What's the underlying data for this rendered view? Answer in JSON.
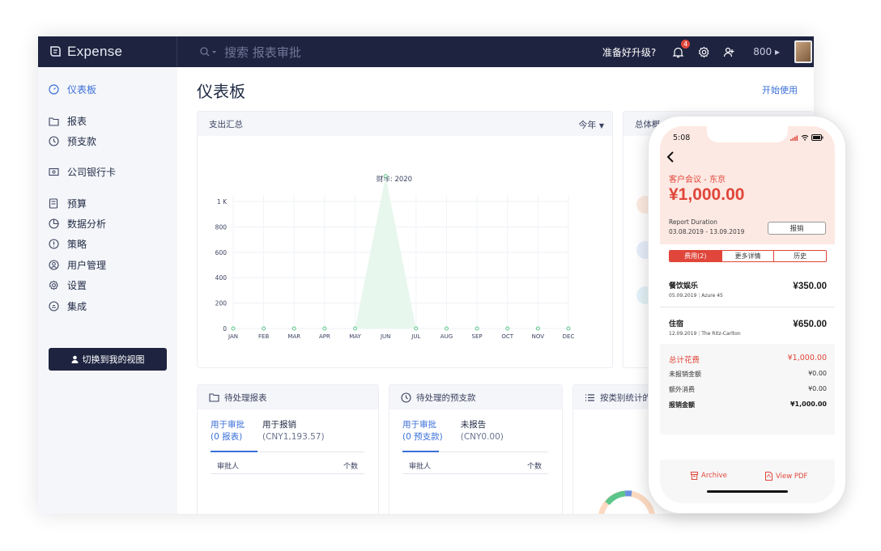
{
  "app": {
    "name": "Expense"
  },
  "header": {
    "search_placeholder": "搜索 报表审批",
    "upgrade_label": "准备好升级?",
    "notif_count": "4",
    "credits": "800"
  },
  "sidebar": {
    "items": [
      {
        "label": "仪表板",
        "icon": "dashboard-icon"
      },
      {
        "label": "报表",
        "icon": "folder-icon"
      },
      {
        "label": "预支款",
        "icon": "clock-icon"
      },
      {
        "label": "公司银行卡",
        "icon": "card-icon"
      },
      {
        "label": "预算",
        "icon": "budget-icon"
      },
      {
        "label": "数据分析",
        "icon": "pie-icon"
      },
      {
        "label": "策略",
        "icon": "policy-icon"
      },
      {
        "label": "用户管理",
        "icon": "user-icon"
      },
      {
        "label": "设置",
        "icon": "gear-icon"
      },
      {
        "label": "集成",
        "icon": "integration-icon"
      }
    ],
    "switch_button": "切换到我的视图"
  },
  "main": {
    "title": "仪表板",
    "start_link": "开始使用",
    "spend_card": {
      "title": "支出汇总",
      "period": "今年"
    },
    "overview_card": {
      "title": "总体概"
    },
    "pending_reports": {
      "title": "待处理报表",
      "tab1": "用于审批",
      "tab1_sub": "(0 报表)",
      "tab2": "用于报销",
      "tab2_sub": "(CNY1,193.57)",
      "col1": "审批人",
      "col2": "个数"
    },
    "pending_advances": {
      "title": "待处理的预支款",
      "tab1": "用于审批",
      "tab1_sub": "(0 预支款)",
      "tab2": "未报告",
      "tab2_sub": "(CNY0.00)",
      "col1": "审批人",
      "col2": "个数"
    },
    "category_card": {
      "title": "按类别统计的"
    }
  },
  "chart_data": {
    "type": "area",
    "title": "财年: 2020",
    "categories": [
      "JAN",
      "FEB",
      "MAR",
      "APR",
      "MAY",
      "JUN",
      "JUL",
      "AUG",
      "SEP",
      "OCT",
      "NOV",
      "DEC"
    ],
    "values": [
      0,
      0,
      0,
      0,
      0,
      1200,
      0,
      0,
      0,
      0,
      0,
      0
    ],
    "yticks": [
      "0",
      "200",
      "400",
      "600",
      "800",
      "1 K"
    ],
    "ylim": [
      0,
      1000
    ],
    "grid": true,
    "colors": {
      "line": "#5cc58a",
      "fill": "#e8f7ee"
    }
  },
  "phone": {
    "time": "5:08",
    "trip": "客户会议 - 东京",
    "amount": "¥1,000.00",
    "duration_label": "Report Duration",
    "duration_value": "03.08.2019 - 13.09.2019",
    "reimburse_button": "报销",
    "tabs": [
      "费用(2)",
      "更多详情",
      "历史"
    ],
    "expenses": [
      {
        "name": "餐饮娱乐",
        "date": "05.09.2019",
        "merchant": "Azure 45",
        "amount": "¥350.00"
      },
      {
        "name": "住宿",
        "date": "12.09.2019",
        "merchant": "The Ritz-Carlton",
        "amount": "¥650.00"
      }
    ],
    "totals": [
      {
        "label": "总计花费",
        "value": "¥1,000.00"
      },
      {
        "label": "未报销金额",
        "value": "¥0.00"
      },
      {
        "label": "额外消费",
        "value": "¥0.00"
      },
      {
        "label": "报销金额",
        "value": "¥1,000.00"
      }
    ],
    "footer": {
      "archive": "Archive",
      "view_pdf": "View PDF"
    },
    "accent": "#e0463a"
  }
}
